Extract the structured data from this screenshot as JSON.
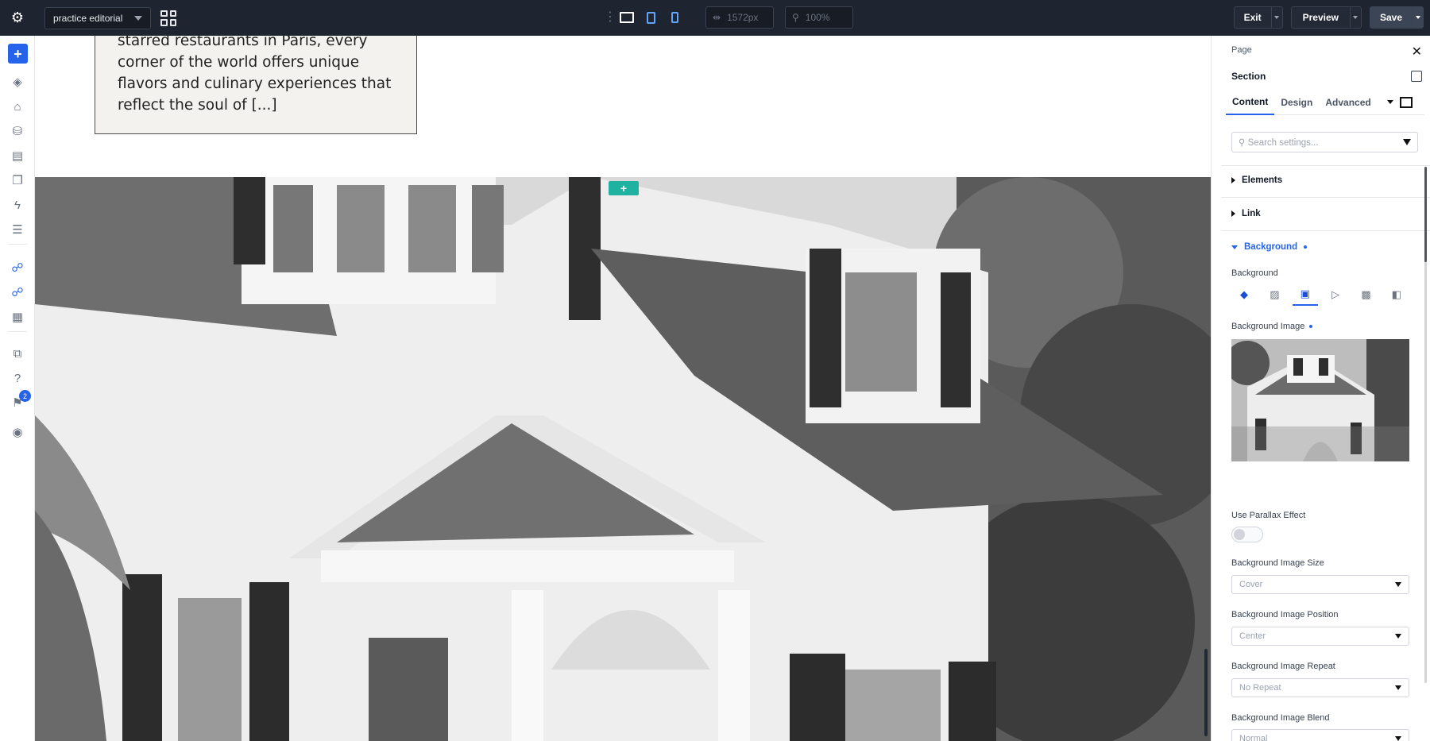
{
  "topbar": {
    "template_select": "practice editorial",
    "width_value": "1572px",
    "zoom_value": "100%",
    "exit_label": "Exit",
    "preview_label": "Preview",
    "save_label": "Save"
  },
  "leftrail": {
    "notification_count": "2",
    "help_label": "?"
  },
  "canvas": {
    "card_text": "starred restaurants in Paris, every corner of the world offers unique flavors and culinary experiences that reflect the soul of [...]",
    "add_section_label": "+"
  },
  "panel": {
    "breadcrumb": "Page",
    "section_title": "Section",
    "tabs": [
      "Content",
      "Design",
      "Advanced"
    ],
    "search_placeholder": "Search settings...",
    "accordions": {
      "elements": "Elements",
      "link": "Link",
      "background": "Background"
    },
    "background_label": "Background",
    "background_image_label": "Background Image",
    "parallax_label": "Use Parallax Effect",
    "size_label": "Background Image Size",
    "size_value": "Cover",
    "position_label": "Background Image Position",
    "position_value": "Center",
    "repeat_label": "Background Image Repeat",
    "repeat_value": "No Repeat",
    "blend_label": "Background Image Blend",
    "blend_value": "Normal"
  },
  "colors": {
    "topbar_bg": "#1e2430",
    "accent_blue": "#2563eb",
    "add_section_teal": "#20b2a0"
  }
}
